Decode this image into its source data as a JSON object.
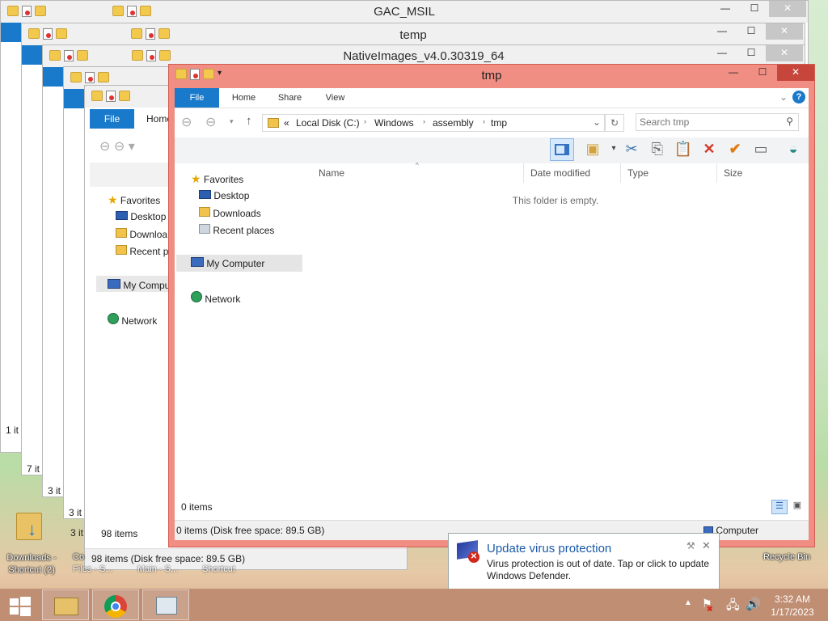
{
  "background_windows": [
    {
      "title": "GAC_MSIL"
    },
    {
      "title": "temp"
    },
    {
      "title": "NativeImages_v4.0.30319_64"
    },
    {
      "status": "98 items",
      "status_bar": "98 items (Disk free space: 89.5 GB)"
    }
  ],
  "peek_status": [
    "1 it",
    "7 it",
    "3 it",
    "3 it",
    "3 it"
  ],
  "back_ribbon": {
    "file": "File",
    "home": "Home"
  },
  "back_nav": {
    "favorites": "Favorites",
    "desktop": "Desktop",
    "downloads": "Downloa",
    "recent": "Recent p",
    "mycomputer": "My Compu",
    "network": "Network"
  },
  "window": {
    "title": "tmp",
    "ribbon_tabs": {
      "file": "File",
      "home": "Home",
      "share": "Share",
      "view": "View"
    },
    "breadcrumb": {
      "chevron": "«",
      "items": [
        "Local Disk (C:)",
        "Windows",
        "assembly",
        "tmp"
      ]
    },
    "search": {
      "placeholder": "Search tmp"
    },
    "columns": {
      "name": "Name",
      "date": "Date modified",
      "type": "Type",
      "size": "Size"
    },
    "empty_text": "This folder is empty.",
    "nav": {
      "favorites": "Favorites",
      "desktop": "Desktop",
      "downloads": "Downloads",
      "recent": "Recent places",
      "mycomputer": "My Computer",
      "network": "Network"
    },
    "status_items": "0 items",
    "status_bar": "0 items (Disk free space: 89.5 GB)",
    "status_right": "Computer"
  },
  "desktop_icons": {
    "downloads": "Downloads -",
    "downloads2": "Shortcut (2)",
    "co": "Co",
    "files": "Files - S...",
    "main": "Main - S...",
    "shortcut": "Shortcut",
    "recycle": "Recycle Bin"
  },
  "toast": {
    "title": "Update virus protection",
    "message": "Virus protection is out of date. Tap or click to update Windows Defender.",
    "colors": {
      "title": "#1a5aa8"
    }
  },
  "clock": {
    "time": "3:32 AM",
    "date": "1/17/2023"
  },
  "colors": {
    "accent": "#1979ca",
    "active_frame": "#f08e83",
    "close": "#c7463c"
  }
}
